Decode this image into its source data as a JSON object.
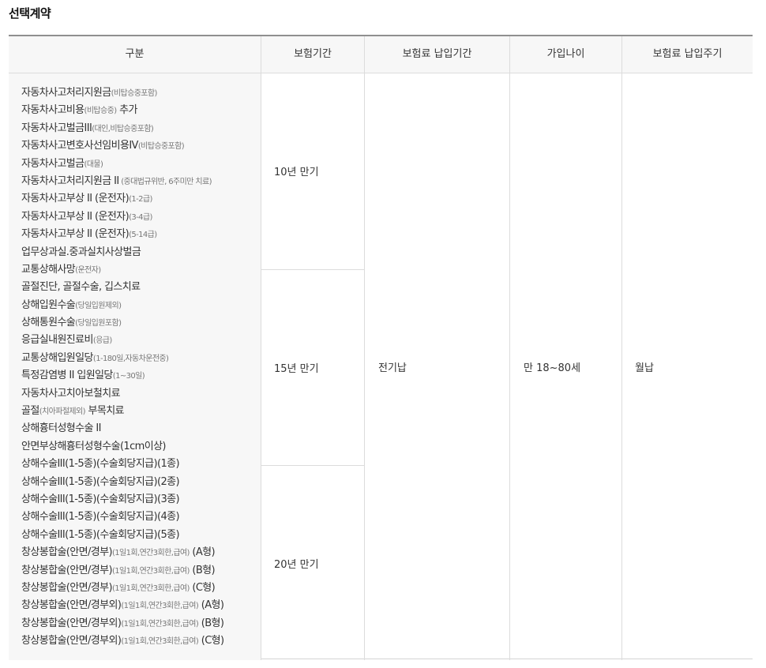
{
  "title": "선택계약",
  "headers": {
    "category": "구분",
    "insurance_period": "보험기간",
    "premium_payment_period": "보험료 납입기간",
    "entry_age": "가입나이",
    "payment_cycle": "보험료 납입주기"
  },
  "coverages": [
    {
      "main": "자동차사고처리지원금",
      "sub": "(비탑승중포함)",
      "tail": ""
    },
    {
      "main": "자동차사고비용",
      "sub": "(비탑승중)",
      "tail": " 추가"
    },
    {
      "main": "자동차사고벌금III",
      "sub": "(대인,비탑승중포함)",
      "tail": ""
    },
    {
      "main": "자동차사고변호사선임비용IV",
      "sub": "(비탑승중포함)",
      "tail": ""
    },
    {
      "main": "자동차사고벌금",
      "sub": "(대물)",
      "tail": ""
    },
    {
      "main": "자동차사고처리지원금 II",
      "sub": " (중대법규위반, 6주미만 치료)",
      "tail": ""
    },
    {
      "main": "자동차사고부상 II (운전자)",
      "sub": "(1-2급)",
      "tail": ""
    },
    {
      "main": "자동차사고부상 II (운전자)",
      "sub": "(3-4급)",
      "tail": ""
    },
    {
      "main": "자동차사고부상 II (운전자)",
      "sub": "(5-14급)",
      "tail": ""
    },
    {
      "main": "업무상과실.중과실치사상벌금",
      "sub": "",
      "tail": ""
    },
    {
      "main": "교통상해사망",
      "sub": "(운전자)",
      "tail": ""
    },
    {
      "main": "골절진단, 골절수술, 깁스치료",
      "sub": "",
      "tail": ""
    },
    {
      "main": "상해입원수술",
      "sub": "(당일입원제외)",
      "tail": ""
    },
    {
      "main": "상해통원수술",
      "sub": "(당일입원포함)",
      "tail": ""
    },
    {
      "main": "응급실내원진료비",
      "sub": "(응급)",
      "tail": ""
    },
    {
      "main": "교통상해입원일당",
      "sub": "(1-180일,자동차운전중)",
      "tail": ""
    },
    {
      "main": "특정감염병 II 입원일당",
      "sub": "(1~30일)",
      "tail": ""
    },
    {
      "main": "자동차사고치아보철치료",
      "sub": "",
      "tail": ""
    },
    {
      "main": "골절",
      "sub": "(치아파절제외)",
      "tail": " 부목치료"
    },
    {
      "main": "상해흉터성형수술 II",
      "sub": "",
      "tail": ""
    },
    {
      "main": "안면부상해흉터성형수술(1cm이상)",
      "sub": "",
      "tail": ""
    },
    {
      "main": "상해수술III(1-5종)(수술회당지급)(1종)",
      "sub": "",
      "tail": ""
    },
    {
      "main": "상해수술III(1-5종)(수술회당지급)(2종)",
      "sub": "",
      "tail": ""
    },
    {
      "main": "상해수술III(1-5종)(수술회당지급)(3종)",
      "sub": "",
      "tail": ""
    },
    {
      "main": "상해수술III(1-5종)(수술회당지급)(4종)",
      "sub": "",
      "tail": ""
    },
    {
      "main": "상해수술III(1-5종)(수술회당지급)(5종)",
      "sub": "",
      "tail": ""
    },
    {
      "main": "창상봉합술(안면/경부)",
      "sub": "(1일1회,연간3회한,급여)",
      "tail": " (A형)"
    },
    {
      "main": "창상봉합술(안면/경부)",
      "sub": "(1일1회,연간3회한,급여)",
      "tail": " (B형)"
    },
    {
      "main": "창상봉합술(안면/경부)",
      "sub": "(1일1회,연간3회한,급여)",
      "tail": " (C형)"
    },
    {
      "main": "창상봉합술(안면/경부외)",
      "sub": "(1일1회,연간3회한,급여)",
      "tail": " (A형)"
    },
    {
      "main": "창상봉합술(안면/경부외)",
      "sub": "(1일1회,연간3회한,급여)",
      "tail": " (B형)"
    },
    {
      "main": "창상봉합술(안면/경부외)",
      "sub": "(1일1회,연간3회한,급여)",
      "tail": " (C형)"
    }
  ],
  "periods": [
    "10년 만기",
    "15년 만기",
    "20년 만기"
  ],
  "premium_payment_period": "전기납",
  "entry_age": "만 18~80세",
  "payment_cycle": "월납"
}
